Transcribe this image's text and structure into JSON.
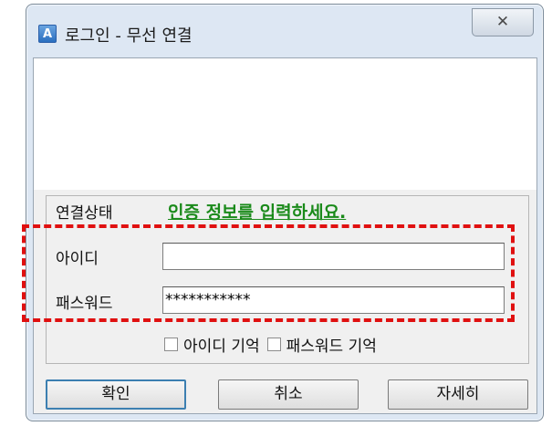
{
  "window": {
    "title": "로그인 - 무선 연결",
    "app_icon_glyph": "A",
    "close_glyph": "✕"
  },
  "form": {
    "status_label": "연결상태",
    "status_message": "인증 정보를 입력하세요.",
    "id_label": "아이디",
    "id_value": "",
    "password_label": "패스워드",
    "password_value": "***********",
    "remember_id_label": "아이디 기억",
    "remember_password_label": "패스워드 기억"
  },
  "buttons": {
    "ok": "확인",
    "cancel": "취소",
    "details": "자세히"
  },
  "colors": {
    "status_message": "#1a8a1a",
    "highlight": "#e01010"
  }
}
